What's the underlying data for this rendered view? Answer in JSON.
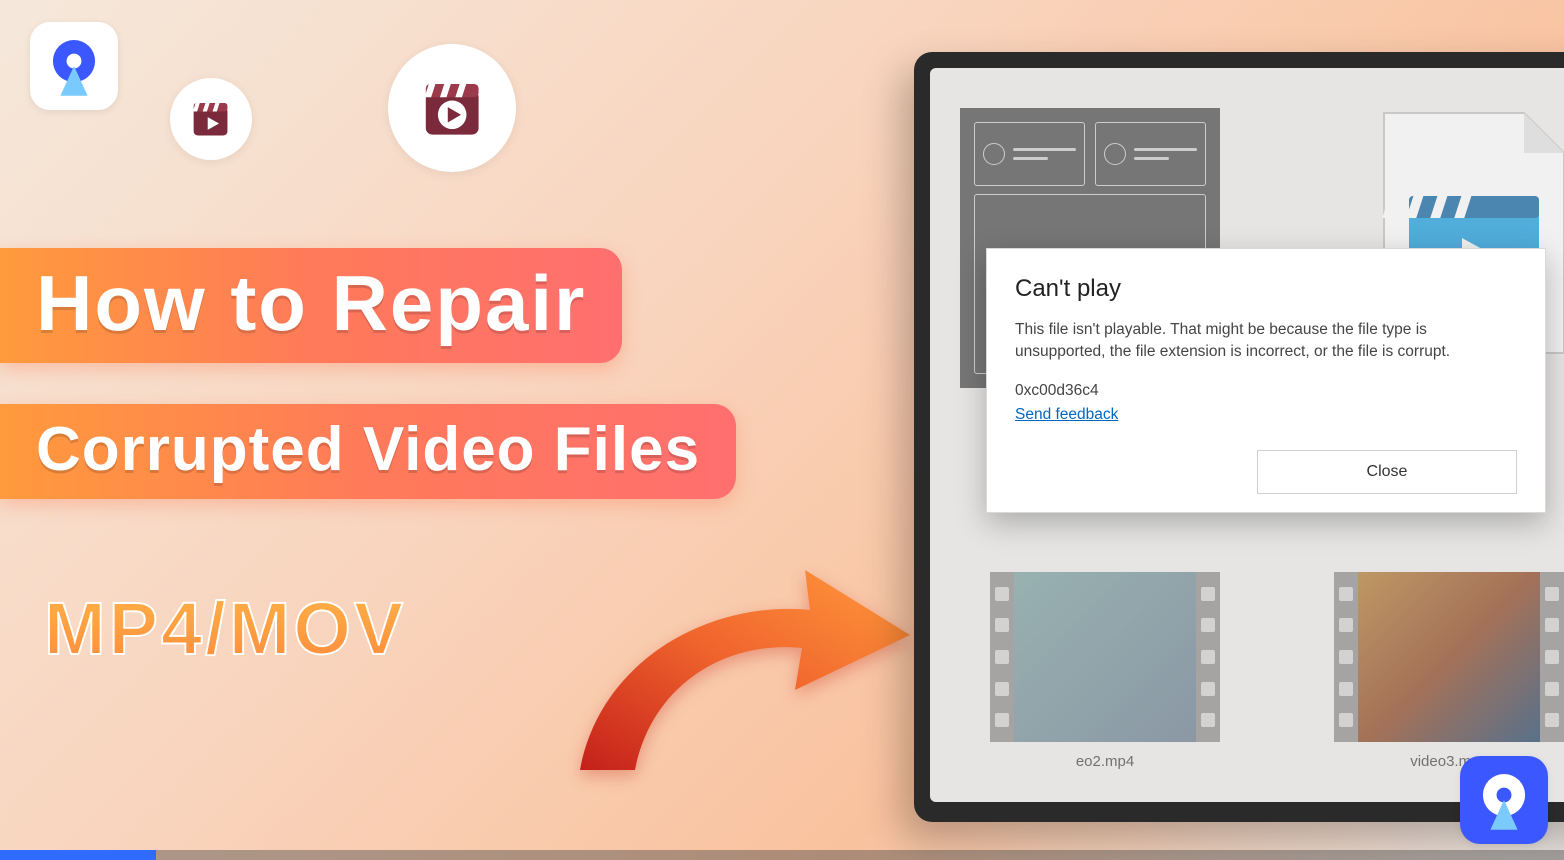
{
  "heading": {
    "line1": "How to Repair",
    "line2": "Corrupted Video Files"
  },
  "formats_label": "MP4/MOV",
  "dialog": {
    "title": "Can't play",
    "body": "This file isn't playable. That might be because the file type is unsupported, the file extension is incorrect, or the file is corrupt.",
    "error_code": "0xc00d36c4",
    "feedback_link": "Send feedback",
    "close_label": "Close"
  },
  "thumbnails": {
    "left_label": "eo2.mp4",
    "right_label": "video3.mp4"
  },
  "icons": {
    "logo": "recoverit-logo-icon",
    "video_small": "video-clapper-play-icon",
    "video_big": "video-clapper-play-icon",
    "arrow": "curved-arrow-icon"
  },
  "progress_percent": 10
}
